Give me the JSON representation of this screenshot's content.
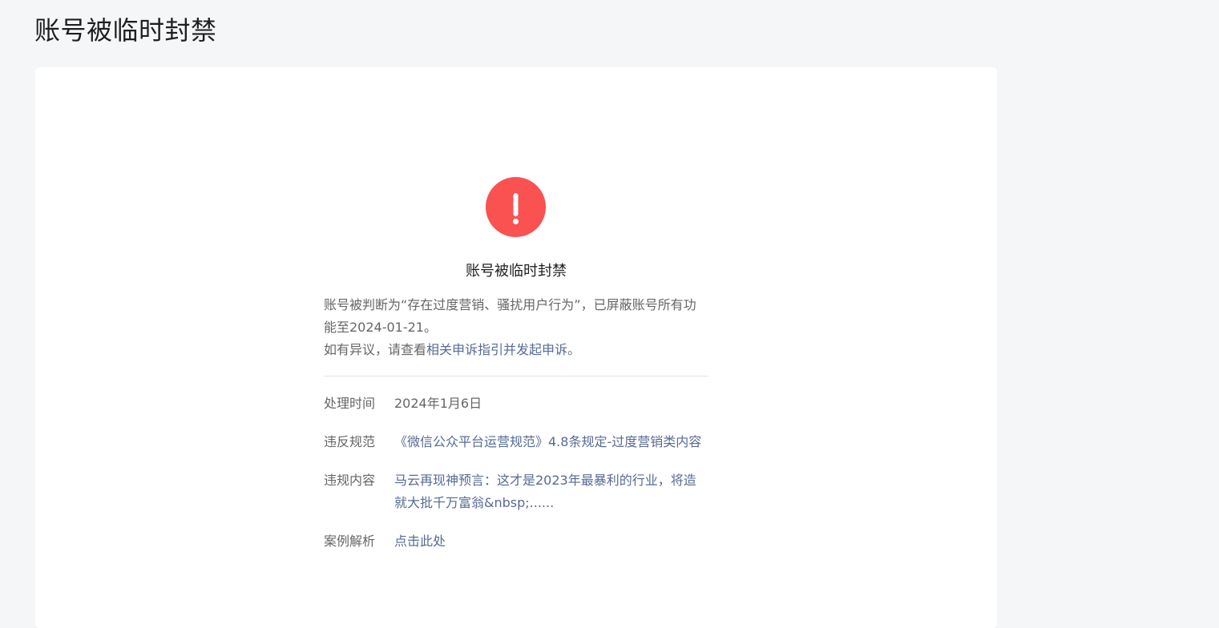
{
  "header": {
    "title": "账号被临时封禁"
  },
  "result": {
    "icon": "exclamation-circle-icon",
    "icon_color": "#fa5151",
    "title": "账号被临时封禁",
    "description_line1": "账号被判断为“存在过度营销、骚扰用户行为”，已屏蔽账号所有功能至2024-01-21。",
    "description_prefix": "如有异议，请查看",
    "appeal_link": "相关申诉指引并发起申诉",
    "description_suffix": "。"
  },
  "details": [
    {
      "label": "处理时间",
      "value": "2024年1月6日"
    },
    {
      "label": "违反规范",
      "value": "《微信公众平台运营规范》4.8条规定-过度营销类内容"
    },
    {
      "label": "违规内容",
      "value": "马云再现神预言：这才是2023年最暴利的行业，将造就大批千万富翁&nbsp;......"
    },
    {
      "label": "案例解析",
      "value": "点击此处"
    }
  ],
  "colors": {
    "background": "#f5f6f7",
    "link": "#576b95",
    "text_secondary": "#666666",
    "danger": "#fa5151"
  }
}
